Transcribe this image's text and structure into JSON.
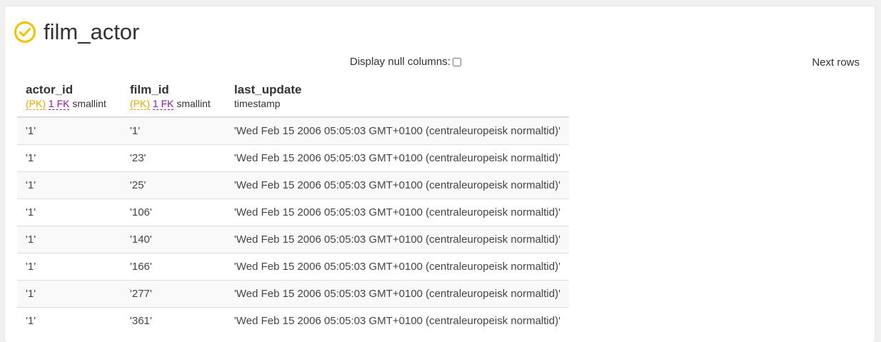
{
  "page": {
    "title": "film_actor",
    "display_null_label": "Display null columns:",
    "next_rows_label": "Next rows",
    "accent_color": "#f2c200"
  },
  "columns": [
    {
      "name": "actor_id",
      "pk": "(PK)",
      "fk": "1 FK",
      "type": "smallint"
    },
    {
      "name": "film_id",
      "pk": "(PK)",
      "fk": "1 FK",
      "type": "smallint"
    },
    {
      "name": "last_update",
      "pk": "",
      "fk": "",
      "type": "timestamp"
    }
  ],
  "rows": [
    [
      "'1'",
      "'1'",
      "'Wed Feb 15 2006 05:05:03 GMT+0100 (centraleuropeisk normaltid)'"
    ],
    [
      "'1'",
      "'23'",
      "'Wed Feb 15 2006 05:05:03 GMT+0100 (centraleuropeisk normaltid)'"
    ],
    [
      "'1'",
      "'25'",
      "'Wed Feb 15 2006 05:05:03 GMT+0100 (centraleuropeisk normaltid)'"
    ],
    [
      "'1'",
      "'106'",
      "'Wed Feb 15 2006 05:05:03 GMT+0100 (centraleuropeisk normaltid)'"
    ],
    [
      "'1'",
      "'140'",
      "'Wed Feb 15 2006 05:05:03 GMT+0100 (centraleuropeisk normaltid)'"
    ],
    [
      "'1'",
      "'166'",
      "'Wed Feb 15 2006 05:05:03 GMT+0100 (centraleuropeisk normaltid)'"
    ],
    [
      "'1'",
      "'277'",
      "'Wed Feb 15 2006 05:05:03 GMT+0100 (centraleuropeisk normaltid)'"
    ],
    [
      "'1'",
      "'361'",
      "'Wed Feb 15 2006 05:05:03 GMT+0100 (centraleuropeisk normaltid)'"
    ]
  ]
}
